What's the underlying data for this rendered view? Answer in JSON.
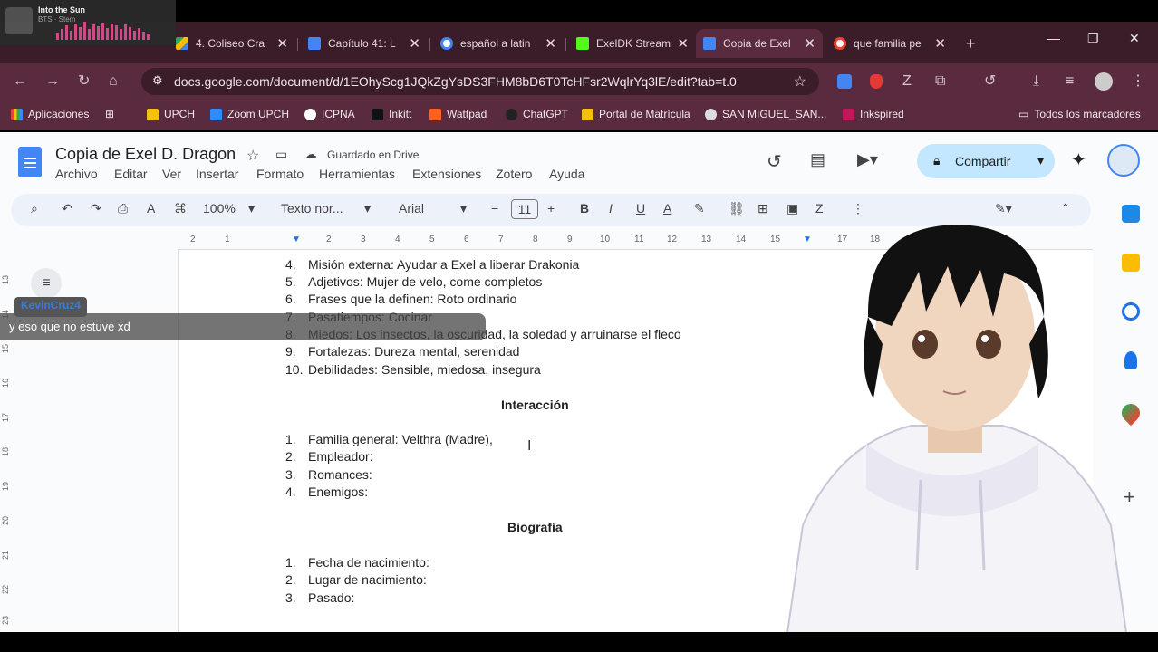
{
  "browser": {
    "tabs": [
      {
        "label": "4. Coliseo Cra",
        "favicon_color": "#34a853"
      },
      {
        "label": "Capítulo 41: L",
        "favicon_color": "#4285f4"
      },
      {
        "label": "español a latin",
        "favicon_color": "#ffffff"
      },
      {
        "label": "ExelDK Stream",
        "favicon_color": "#53fc18"
      },
      {
        "label": "Copia de Exel",
        "favicon_color": "#4285f4"
      },
      {
        "label": "que familia pe",
        "favicon_color": "#ffffff"
      }
    ],
    "url": "docs.google.com/document/d/1EOhyScg1JQkZgYsDS3FHM8bD6T0TcHFsr2WqlrYq3lE/edit?tab=t.0",
    "bookmarks": [
      {
        "label": "Aplicaciones"
      },
      {
        "label": "UPCH"
      },
      {
        "label": "Zoom UPCH"
      },
      {
        "label": "ICPNA"
      },
      {
        "label": "Inkitt"
      },
      {
        "label": "Wattpad"
      },
      {
        "label": "ChatGPT"
      },
      {
        "label": "Portal de Matrícula"
      },
      {
        "label": "SAN MIGUEL_SAN..."
      },
      {
        "label": "Inkspired"
      }
    ],
    "all_bookmarks": "Todos los marcadores"
  },
  "music": {
    "title": "Into the Sun",
    "artist": "BTS · Stem"
  },
  "docs": {
    "title": "Copia de Exel D. Dragon",
    "save_status": "Guardado en Drive",
    "menu": [
      "Archivo",
      "Editar",
      "Ver",
      "Insertar",
      "Formato",
      "Herramientas",
      "Extensiones",
      "Zotero",
      "Ayuda"
    ],
    "share_label": "Compartir",
    "zoom": "100%",
    "style": "Texto nor...",
    "font": "Arial",
    "font_size": "11",
    "ruler": [
      "2",
      "1",
      "1",
      "2",
      "3",
      "4",
      "5",
      "6",
      "7",
      "8",
      "9",
      "10",
      "11",
      "12",
      "13",
      "14",
      "15",
      "16",
      "17",
      "18"
    ],
    "vruler": [
      "13",
      "14",
      "15",
      "16",
      "17",
      "18",
      "19",
      "20",
      "21",
      "22",
      "23"
    ],
    "list1": [
      {
        "n": "4.",
        "text": "Misión externa: Ayudar a Exel a liberar Drakonia"
      },
      {
        "n": "5.",
        "text": "Adjetivos: Mujer de velo, come completos"
      },
      {
        "n": "6.",
        "text": "Frases que la definen: Roto ordinario"
      },
      {
        "n": "7.",
        "text": "Pasatiempos: Cocinar"
      },
      {
        "n": "8.",
        "text": "Miedos: Los insectos, la oscuridad, la soledad y arruinarse el fleco"
      },
      {
        "n": "9.",
        "text": "Fortalezas: Dureza mental, serenidad"
      },
      {
        "n": "10.",
        "text": "Debilidades: Sensible, miedosa, insegura"
      }
    ],
    "heading_interaccion": "Interacción",
    "list2": [
      {
        "n": "1.",
        "text": "Familia general: Velthra (Madre),"
      },
      {
        "n": "2.",
        "text": "Empleador:"
      },
      {
        "n": "3.",
        "text": "Romances:"
      },
      {
        "n": "4.",
        "text": "Enemigos:"
      }
    ],
    "heading_biografia": "Biografía",
    "list3": [
      {
        "n": "1.",
        "text": "Fecha de nacimiento:"
      },
      {
        "n": "2.",
        "text": "Lugar de nacimiento:"
      },
      {
        "n": "3.",
        "text": "Pasado:"
      }
    ]
  },
  "chat": {
    "username": "KevinCruz4",
    "message": "y eso que no estuve xd"
  }
}
